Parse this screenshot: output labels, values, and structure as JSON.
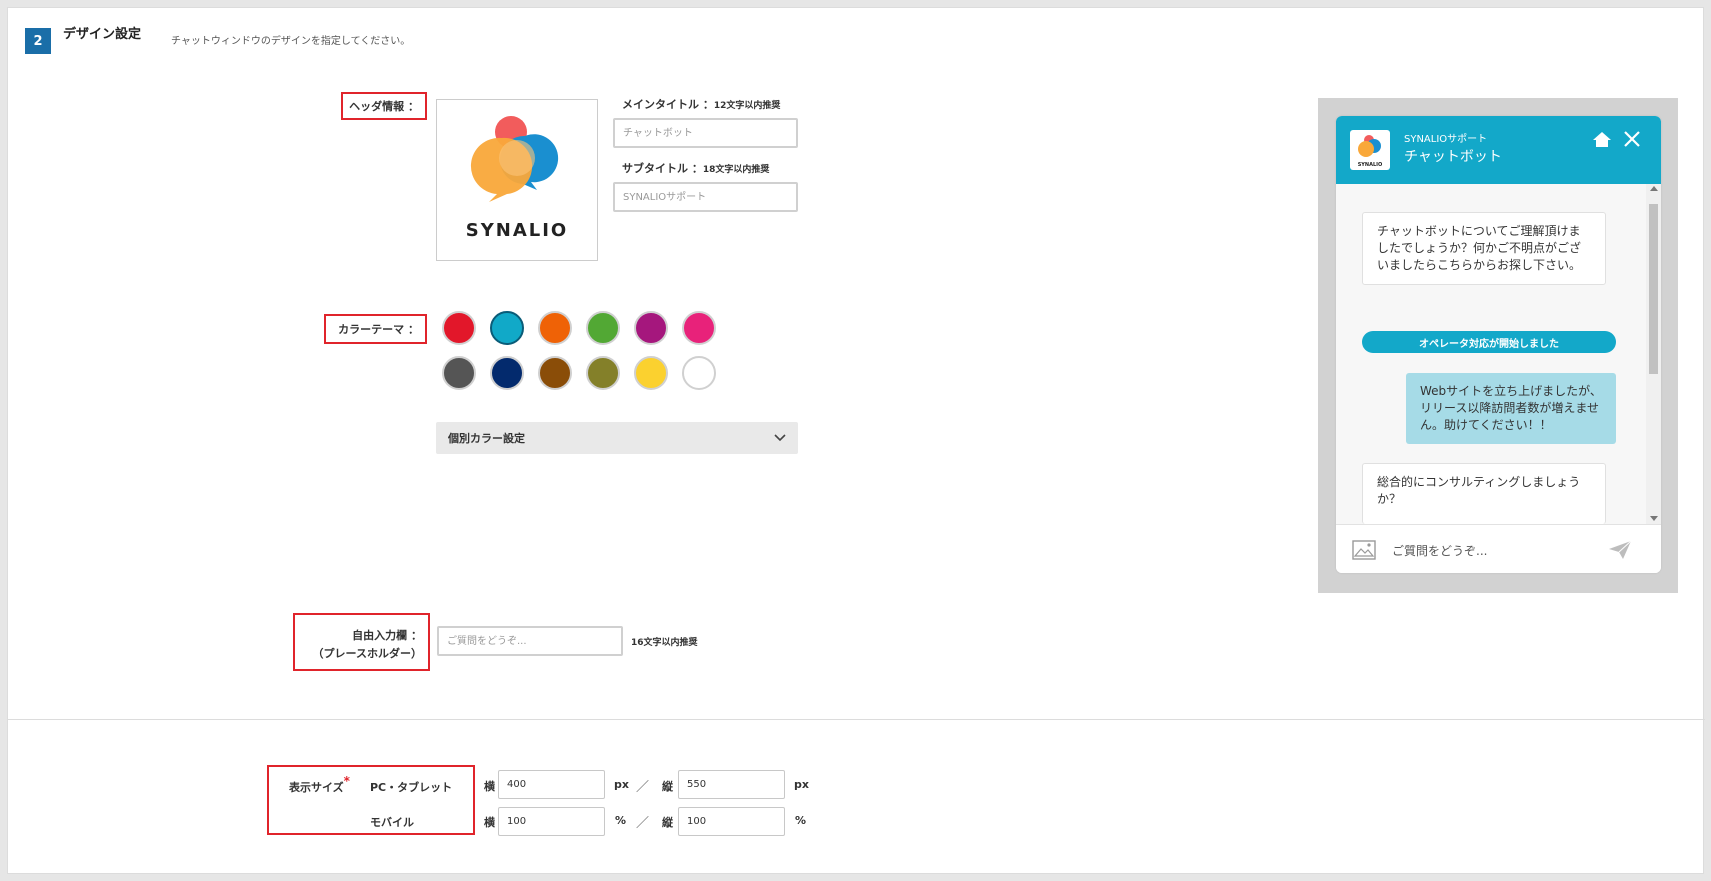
{
  "section": {
    "step": "2",
    "title": "デザイン設定",
    "description": "チャットウィンドウのデザインを指定してください。"
  },
  "header_info": {
    "label": "ヘッダ情報 ：",
    "logo_text": "SYNALIO",
    "main_title_label": "メインタイトル ：",
    "main_title_hint": "12文字以内推奨",
    "main_title_placeholder": "チャットボット",
    "sub_title_label": "サブタイトル ：",
    "sub_title_hint": "18文字以内推奨",
    "sub_title_placeholder": "SYNALIOサポート"
  },
  "color_theme": {
    "label": "カラーテーマ ：",
    "selected_index": 1,
    "colors": [
      "#e2172a",
      "#11a9c8",
      "#ef6206",
      "#52a834",
      "#a5177d",
      "#e8227a",
      "#555555",
      "#032a6d",
      "#8a4d08",
      "#848029",
      "#fbd12f",
      "#ffffff"
    ],
    "individual_label": "個別カラー設定"
  },
  "free_input": {
    "label_line1": "自由入力欄 ：",
    "label_line2": "（プレースホルダー）",
    "placeholder": "ご質問をどうぞ...",
    "hint": "16文字以内推奨"
  },
  "display_size": {
    "label": "表示サイズ",
    "required_mark": "*",
    "pc_label": "PC・タブレット",
    "mobile_label": "モバイル",
    "width_label": "横",
    "height_label": "縦",
    "separator": "／",
    "pc_width": "400",
    "pc_height": "550",
    "pc_unit": "px",
    "mobile_width": "100",
    "mobile_height": "100",
    "mobile_unit": "%"
  },
  "preview": {
    "subtitle": "SYNALIOサポート",
    "title": "チャットボット",
    "logo_text": "SYNALIO",
    "messages": {
      "bot1": "チャットボットについてご理解頂けましたでしょうか？何かご不明点がございましたらこちらからお探し下さい。",
      "notice": "オペレータ対応が開始しました",
      "user1": "Webサイトを立ち上げましたが、リリース以降訪問者数が増えません。助けてください！！",
      "bot2": "総合的にコンサルティングしましょうか？"
    },
    "input_placeholder": "ご質問をどうぞ..."
  }
}
